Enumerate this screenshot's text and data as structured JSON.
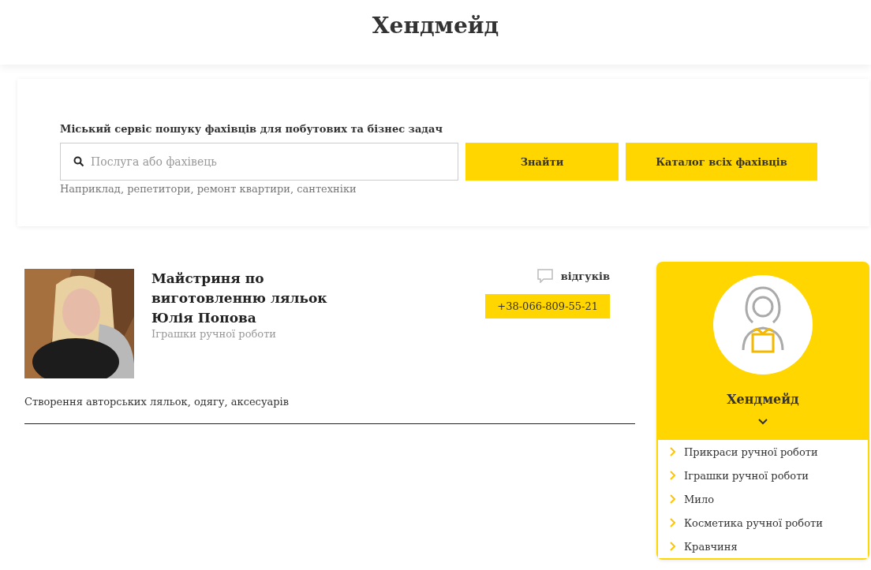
{
  "header": {
    "title": "Хендмейд"
  },
  "search": {
    "tagline": "Міський сервіс пошуку фахівців для побутових та бізнес задач",
    "placeholder": "Послуга або фахівець",
    "find_button": "Знайти",
    "catalog_button": "Каталог всіх фахівців",
    "hint": "Наприклад, репетитори, ремонт квартири, сантехніки"
  },
  "listing": {
    "name": "Майстриня по виготовленню ляльок Юлія Попова",
    "category": "Іграшки ручної роботи",
    "reviews": "відгуків",
    "phone": "+38-066-809-55-21",
    "description": "Створення авторських ляльок, одягу, аксесуарів"
  },
  "sidebar": {
    "title": "Хендмейд",
    "expanded": true,
    "items": [
      {
        "label": "Прикраси ручної роботи"
      },
      {
        "label": "Іграшки ручної роботи"
      },
      {
        "label": "Мило"
      },
      {
        "label": "Косметика ручної роботи"
      },
      {
        "label": "Кравчиня"
      }
    ]
  }
}
